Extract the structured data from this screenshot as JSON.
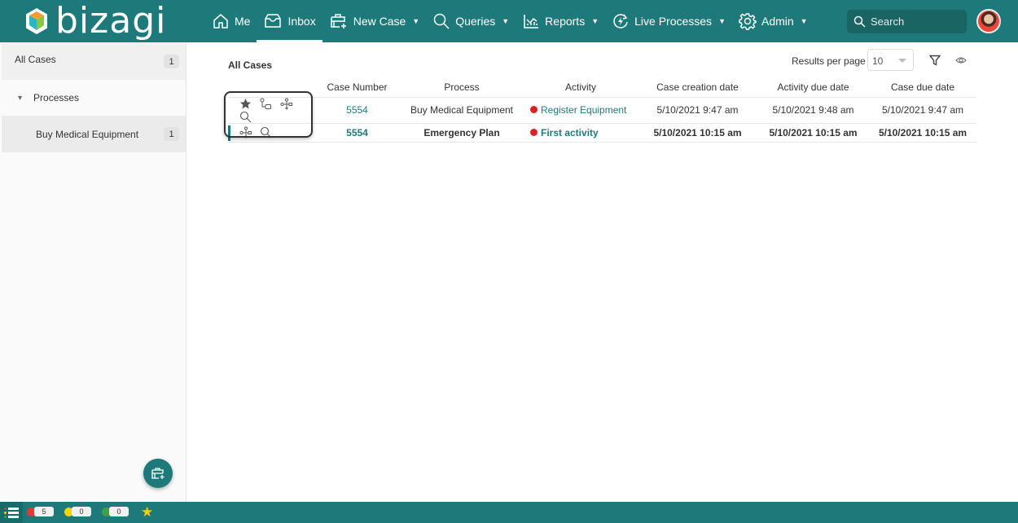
{
  "header": {
    "logo_text": "bizagi",
    "nav": [
      {
        "label": "Me",
        "icon": "home-icon",
        "caret": false,
        "active": false
      },
      {
        "label": "Inbox",
        "icon": "inbox-icon",
        "caret": false,
        "active": true
      },
      {
        "label": "New Case",
        "icon": "new-case-icon",
        "caret": true,
        "active": false
      },
      {
        "label": "Queries",
        "icon": "search-icon",
        "caret": true,
        "active": false
      },
      {
        "label": "Reports",
        "icon": "chart-icon",
        "caret": true,
        "active": false
      },
      {
        "label": "Live Processes",
        "icon": "live-processes-icon",
        "caret": true,
        "active": false
      },
      {
        "label": "Admin",
        "icon": "gear-icon",
        "caret": true,
        "active": false
      }
    ],
    "caret_glyph": "▼",
    "search_placeholder": "Search"
  },
  "sidebar": {
    "all_cases": {
      "label": "All Cases",
      "count": "1"
    },
    "processes": {
      "label": "Processes",
      "expand_glyph": "▾"
    },
    "process_items": [
      {
        "label": "Buy Medical Equipment",
        "count": "1"
      }
    ]
  },
  "main": {
    "title": "All Cases",
    "results_per_page_label": "Results per page",
    "results_per_page_value": "10",
    "table": {
      "columns": [
        "",
        "Case Number",
        "Process",
        "Activity",
        "Case creation date",
        "Activity due date",
        "Case due date"
      ],
      "rows": [
        {
          "icons": [
            "favorite-star-icon",
            "subprocess-icon",
            "workflow-icon",
            "search-icon"
          ],
          "case_number": "5554",
          "process": "Buy Medical Equipment",
          "activity": "Register Equipment",
          "status_color": "#e02020",
          "case_creation_date": "5/10/2021 9:47 am",
          "activity_due_date": "5/10/2021 9:48 am",
          "case_due_date": "5/10/2021 9:47 am",
          "bold": false
        },
        {
          "icons": [
            "workflow-icon",
            "search-icon"
          ],
          "case_number": "5554",
          "process": "Emergency Plan",
          "activity": "First activity",
          "status_color": "#e02020",
          "case_creation_date": "5/10/2021 10:15 am",
          "activity_due_date": "5/10/2021 10:15 am",
          "case_due_date": "5/10/2021 10:15 am",
          "bold": true
        }
      ]
    }
  },
  "footer": {
    "counters": [
      {
        "name": "overdue",
        "color": "#e53935",
        "value": "5"
      },
      {
        "name": "due-today",
        "color": "#f2d600",
        "value": "0"
      },
      {
        "name": "on-time",
        "color": "#43a047",
        "value": "0"
      }
    ],
    "star_glyph": "★"
  },
  "colors": {
    "brand": "#1e7a7a",
    "link": "#1e7a7a",
    "overdue": "#e02020"
  }
}
